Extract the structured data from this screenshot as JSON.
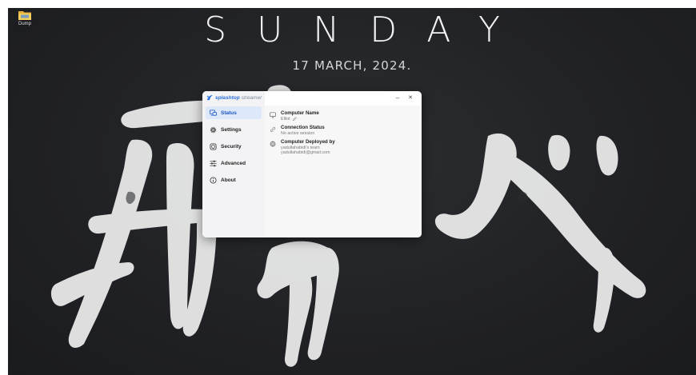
{
  "desktop": {
    "icon_label": "Dump",
    "day": "SUNDAY",
    "date": "17 MARCH, 2024."
  },
  "app": {
    "brand_bold": "splashtop",
    "brand_light": "streamer",
    "window_controls": {
      "minimize": "–",
      "close": "✕"
    },
    "nav": [
      {
        "label": "Status",
        "icon": "monitor-icon",
        "active": true
      },
      {
        "label": "Settings",
        "icon": "gear-icon",
        "active": false
      },
      {
        "label": "Security",
        "icon": "shield-icon",
        "active": false
      },
      {
        "label": "Advanced",
        "icon": "sliders-icon",
        "active": false
      },
      {
        "label": "About",
        "icon": "info-icon",
        "active": false
      }
    ],
    "status": {
      "computer_name_title": "Computer Name",
      "computer_name_value": "Elliot",
      "connection_title": "Connection Status",
      "connection_value": "No active session",
      "deployed_title": "Computer Deployed by",
      "deployed_team": "yadullahabidi's team",
      "deployed_email": "yadullahabidi@gmail.com"
    }
  },
  "colors": {
    "accent": "#1a56c4",
    "active_nav_bg": "#dde8fb",
    "desktop_bg": "#202124"
  }
}
